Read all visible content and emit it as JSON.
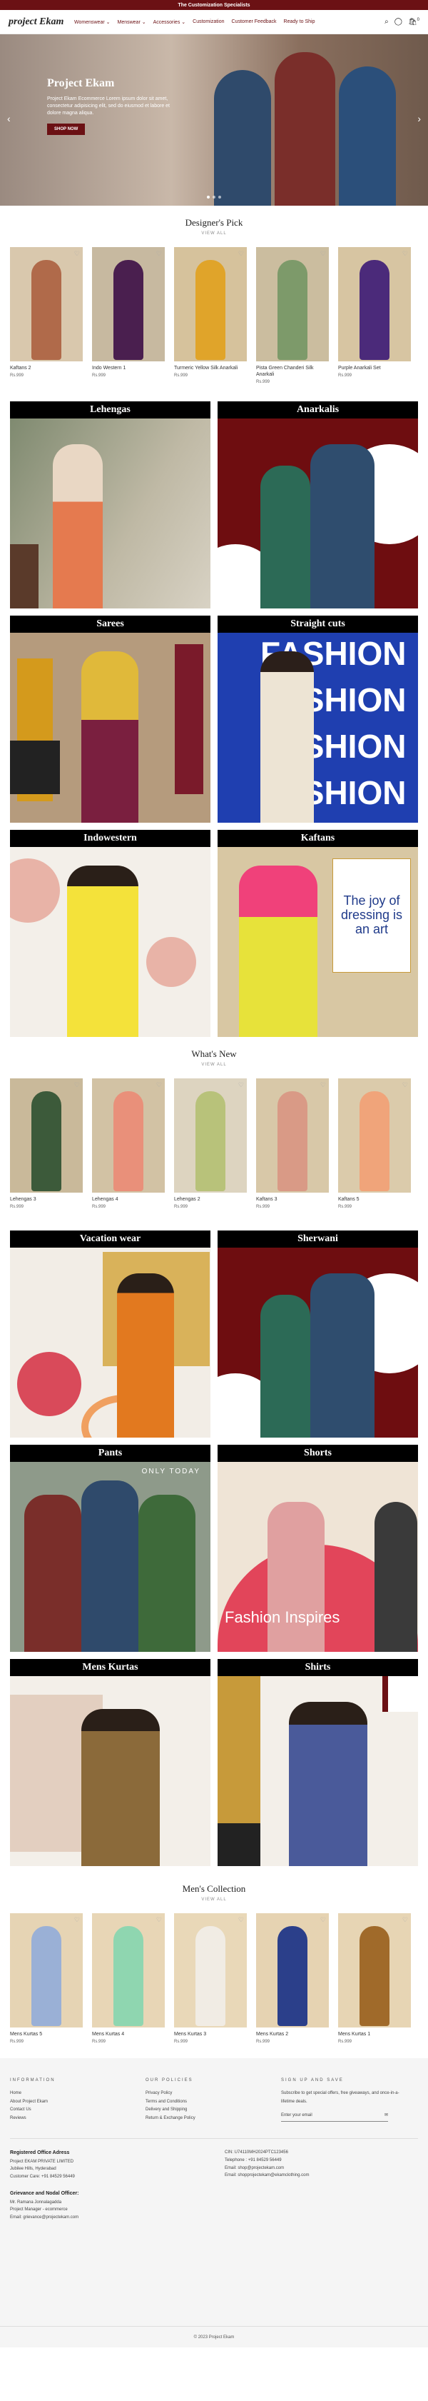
{
  "announcement": "The Customization Specialists",
  "header": {
    "logo": "project Ekam",
    "nav": [
      "Womenswear ⌄",
      "Menswear ⌄",
      "Accessories ⌄",
      "Customization",
      "Customer Feedback",
      "Ready to Ship"
    ],
    "cart_count": "0"
  },
  "hero": {
    "title": "Project Ekam",
    "text": "Project Ekam Ecommerce Lorem ipsum dolor sit amet, consectetur adipisicing elit, sed do eiusmod et labore et dolore magna aliqua.",
    "button": "SHOP NOW"
  },
  "designers_pick": {
    "title": "Designer's Pick",
    "view_all": "VIEW ALL",
    "products": [
      {
        "name": "Kaftans 2",
        "price": "Rs.999"
      },
      {
        "name": "Indo Western 1",
        "price": "Rs.999"
      },
      {
        "name": "Turmeric Yellow Silk Anarkali",
        "price": "Rs.999"
      },
      {
        "name": "Pista Green Chanderi Silk Anarkali",
        "price": "Rs.999"
      },
      {
        "name": "Purple Anarkali Set",
        "price": "Rs.999"
      }
    ]
  },
  "categories_1": [
    {
      "label": "Lehengas"
    },
    {
      "label": "Anarkalis"
    },
    {
      "label": "Sarees"
    },
    {
      "label": "Straight cuts",
      "overlay": "FASHION"
    },
    {
      "label": "Indowestern"
    },
    {
      "label": "Kaftans",
      "overlay": "The joy of dressing is an art"
    }
  ],
  "whats_new": {
    "title": "What's New",
    "view_all": "VIEW ALL",
    "products": [
      {
        "name": "Lehengas 3",
        "price": "Rs.999"
      },
      {
        "name": "Lehengas 4",
        "price": "Rs.999"
      },
      {
        "name": "Lehengas 2",
        "price": "Rs.999"
      },
      {
        "name": "Kaftans 3",
        "price": "Rs.999"
      },
      {
        "name": "Kaftans 5",
        "price": "Rs.999"
      }
    ]
  },
  "categories_2": [
    {
      "label": "Vacation wear"
    },
    {
      "label": "Sherwani"
    },
    {
      "label": "Pants",
      "overlay": "ONLY TODAY"
    },
    {
      "label": "Shorts",
      "overlay": "Fashion Inspires"
    },
    {
      "label": "Mens Kurtas"
    },
    {
      "label": "Shirts"
    }
  ],
  "mens_collection": {
    "title": "Men's Collection",
    "view_all": "VIEW ALL",
    "products": [
      {
        "name": "Mens Kurtas 5",
        "price": "Rs.999"
      },
      {
        "name": "Mens Kurtas 4",
        "price": "Rs.999"
      },
      {
        "name": "Mens Kurtas 3",
        "price": "Rs.999"
      },
      {
        "name": "Mens Kurtas 2",
        "price": "Rs.999"
      },
      {
        "name": "Mens Kurtas 1",
        "price": "Rs.999"
      }
    ]
  },
  "footer": {
    "info_title": "INFORMATION",
    "info_links": [
      "Home",
      "About Project Ekam",
      "Contact Us",
      "Reviews"
    ],
    "policies_title": "OUR POLICIES",
    "policy_links": [
      "Privacy Policy",
      "Terms and Conditions",
      "Delivery and Shipping",
      "Return & Exchange Policy"
    ],
    "signup_title": "SIGN UP AND SAVE",
    "signup_text": "Subscribe to get special offers, free giveaways, and once-in-a-lifetime deals.",
    "email_placeholder": "Enter your email",
    "registered_title": "Registered Office Adress",
    "registered_lines": [
      "Project EKAM PRIVATE LIMITED",
      "Jubilee Hills, Hyderabad",
      "Customer Care: +91 84529 56449"
    ],
    "contact_lines": [
      "CIN: U74110MH2024PTC123456",
      "Telephone : +91 84529 56449",
      "Email: shop@projectekam.com",
      "Email: shopprojectekam@ekamclothing.com"
    ],
    "grievance_title": "Grievance and Nodal Officer:",
    "grievance_lines": [
      "Mr. Ramana Jonnalagadda",
      "Project Manager - ecommerce",
      "Email: grievance@projectekam.com"
    ],
    "copyright": "2023 Project Ekam"
  }
}
